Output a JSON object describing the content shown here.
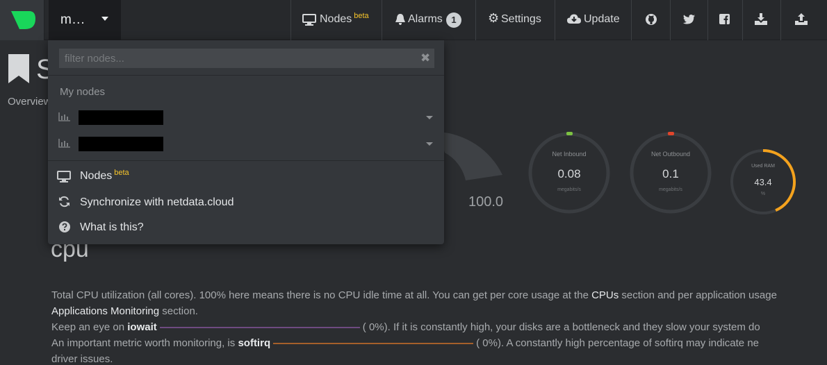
{
  "navbar": {
    "host_name": "m...",
    "nodes_label": "Nodes",
    "nodes_beta": "beta",
    "alarms_label": "Alarms",
    "alarms_count": "1",
    "settings_label": "Settings",
    "update_label": "Update",
    "icons": [
      "github-icon",
      "twitter-icon",
      "facebook-icon",
      "download-icon",
      "upload-icon"
    ]
  },
  "dropdown": {
    "filter_placeholder": "filter nodes...",
    "clear_glyph": "✖",
    "section_title": "My nodes",
    "menu": {
      "nodes_label": "Nodes",
      "nodes_beta": "beta",
      "sync_label": "Synchronize with netdata.cloud",
      "what_label": "What is this?"
    }
  },
  "background": {
    "section_initial": "S",
    "overview_label": "Overview",
    "gauge_value": "100.0",
    "cpu_title": "cpu",
    "desc_line1_a": "Total CPU utilization (all cores). 100% here means there is no CPU idle time at all. You can get per core usage at the ",
    "desc_line1_cpus": "CPUs",
    "desc_line1_b": " section and per application usage",
    "desc_line2_apps": "Applications Monitoring",
    "desc_line2_b": " section.",
    "desc_line3_a": "Keep an eye on ",
    "desc_line3_iowait": "iowait",
    "desc_line3_b": "(           0%). If it is constantly high, your disks are a bottleneck and they slow your system do",
    "desc_line4_a": "An important metric worth monitoring, is ",
    "desc_line4_softirq": "softirq",
    "desc_line4_b": "(           0%). A constantly high percentage of softirq may indicate ne",
    "desc_line5": "driver issues."
  },
  "dials": [
    {
      "title": "Net Inbound",
      "value": "0.08",
      "unit": "megabits/s",
      "dot_color": "#7cc142"
    },
    {
      "title": "Net Outbound",
      "value": "0.1",
      "unit": "megabits/s",
      "dot_color": "#e0452b"
    },
    {
      "title": "Used RAM",
      "value": "43.4",
      "unit": "%",
      "arc_color": "#f4a21d",
      "fraction": 0.434
    }
  ],
  "colors": {
    "brand": "#19d65a",
    "beta": "#f7c52b",
    "iowait_line": "#9b59b6",
    "softirq_line": "#e67e22"
  }
}
